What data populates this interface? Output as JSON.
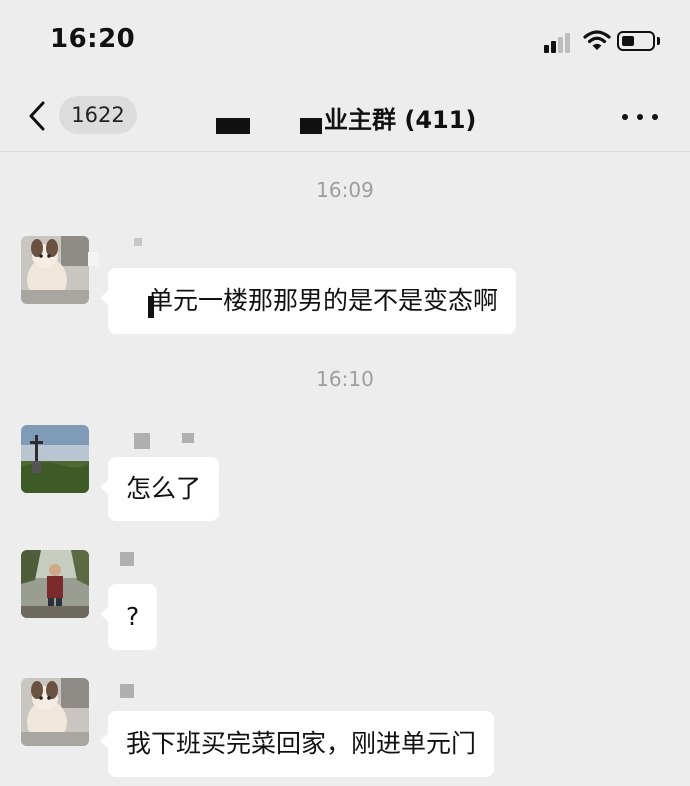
{
  "status_bar": {
    "time": "16:20",
    "icons": [
      "cellular-signal-icon",
      "wifi-icon",
      "battery-icon"
    ]
  },
  "nav": {
    "back_icon": "chevron-left-icon",
    "unread_count": "1622",
    "title": "业主群 (411)",
    "more_icon": "more-horizontal-icon"
  },
  "messages": [
    {
      "type": "timestamp",
      "text": "16:09"
    },
    {
      "type": "message",
      "avatar": "dog-photo-avatar",
      "text": "单元一楼那那男的是不是变态啊"
    },
    {
      "type": "timestamp",
      "text": "16:10"
    },
    {
      "type": "message",
      "avatar": "landscape-cross-photo-avatar",
      "text": "怎么了"
    },
    {
      "type": "message",
      "avatar": "person-outdoor-photo-avatar",
      "text": "?"
    },
    {
      "type": "message",
      "avatar": "dog-photo-avatar",
      "text": "我下班买完菜回家，刚进单元门"
    }
  ],
  "colors": {
    "background": "#ededed",
    "bubble": "#ffffff",
    "timestamp_text": "#9e9e9e",
    "badge_bg": "#dcdcdc"
  }
}
